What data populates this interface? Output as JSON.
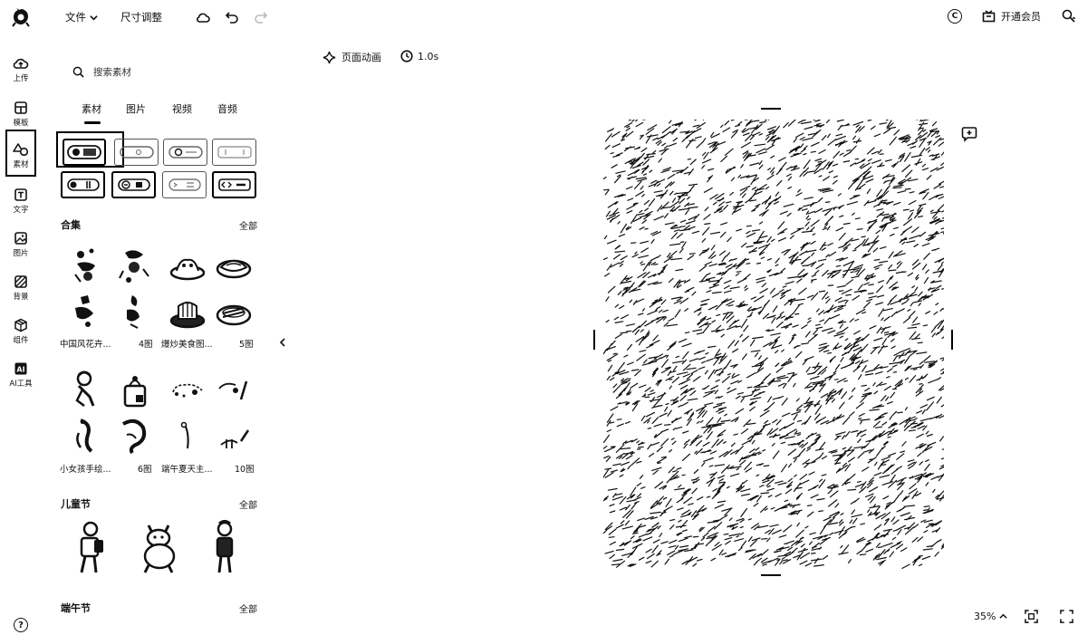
{
  "header": {
    "file_menu": "文件",
    "resize": "尺寸调整",
    "vip": "开通会员"
  },
  "nav": {
    "upload": "上传",
    "template": "模板",
    "material": "素材",
    "text": "文字",
    "image": "图片",
    "background": "背景",
    "component": "组件",
    "ai_tools": "AI工具"
  },
  "panel": {
    "search_placeholder": "搜索素材",
    "tabs": [
      "素材",
      "图片",
      "视频",
      "音频"
    ],
    "active_tab": "素材",
    "sections": {
      "collection": {
        "title": "合集",
        "all": "全部",
        "items": [
          {
            "name": "中国风花卉...",
            "count": "4图"
          },
          {
            "name": "爆炒美食图...",
            "count": "5图"
          },
          {
            "name": "小女孩手绘...",
            "count": "6图"
          },
          {
            "name": "端午夏天主...",
            "count": "10图"
          }
        ]
      },
      "children_day": {
        "title": "儿童节",
        "all": "全部"
      },
      "dragon_boat": {
        "title": "端午节",
        "all": "全部"
      }
    }
  },
  "canvas": {
    "animation": "页面动画",
    "duration": "1.0s",
    "zoom": "35%"
  },
  "colors": {
    "ink": "#111111",
    "background": "#ffffff"
  }
}
